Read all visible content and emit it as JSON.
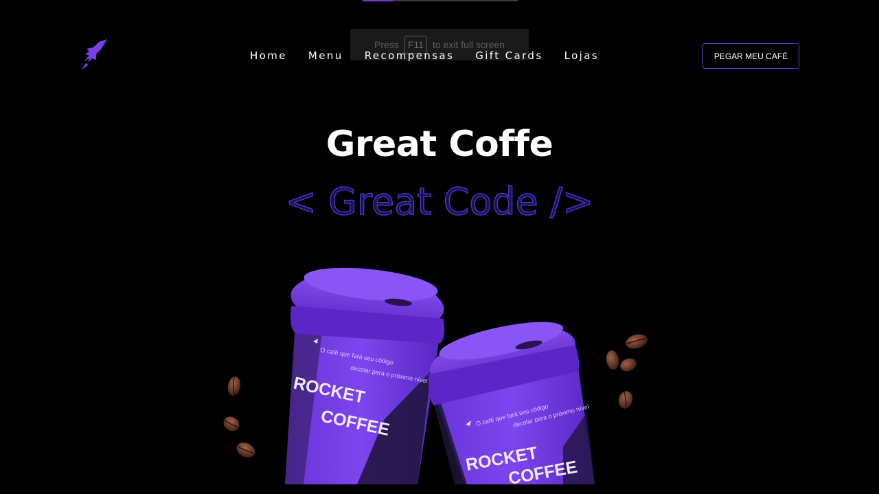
{
  "fullscreen_hint": {
    "prefix": "Press",
    "key": "F11",
    "suffix": "to exit full screen"
  },
  "header": {
    "logo_icon": "rocket-icon",
    "nav": [
      {
        "label": "Home"
      },
      {
        "label": "Menu"
      },
      {
        "label": "Recompensas"
      },
      {
        "label": "Gift Cards"
      },
      {
        "label": "Lojas"
      }
    ],
    "cta_label": "PEGAR MEU CAFÉ"
  },
  "hero": {
    "title": "Great Coffe",
    "subtitle": "< Great Code />"
  },
  "cups": [
    {
      "tagline_1": "O café que fará seu código",
      "tagline_2": "decolar para o próximo nível",
      "brand_1": "ROCKET",
      "brand_2": "COFFEE"
    },
    {
      "tagline_1": "O café que fará seu código",
      "tagline_2": "decolar para o próximo nível",
      "brand_1": "ROCKET",
      "brand_2": "COFFEE"
    }
  ],
  "colors": {
    "background": "#000000",
    "accent_purple": "#7b3fe4",
    "outline_purple": "#4a35c9"
  }
}
